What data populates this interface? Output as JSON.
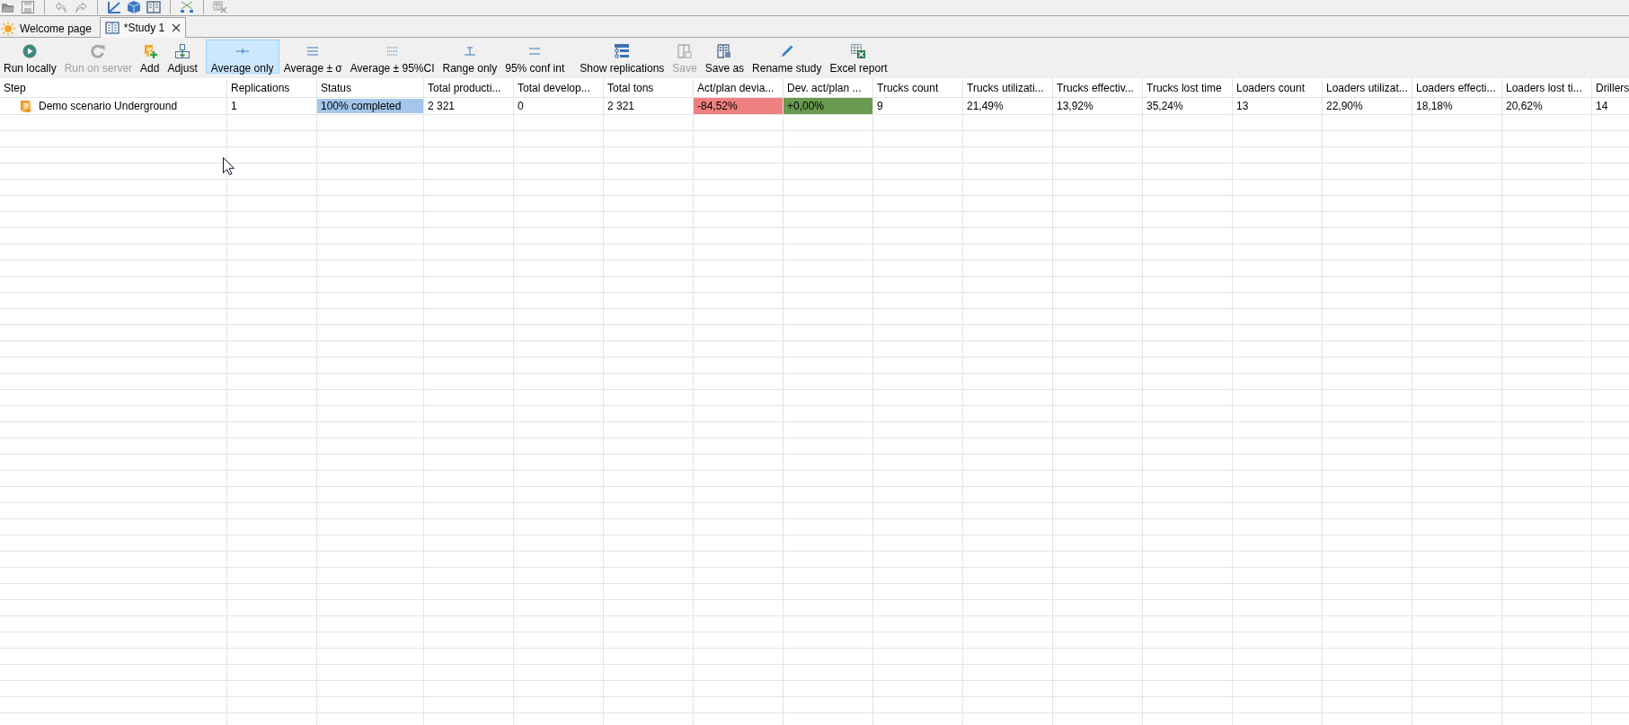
{
  "tabs": [
    {
      "kind": "welcome",
      "label": "Welcome page",
      "selected": false
    },
    {
      "kind": "study",
      "label": "*Study 1",
      "selected": true
    }
  ],
  "toolbar": {
    "run_group": [
      {
        "kind": "run",
        "label": "Run locally",
        "disabled": false
      },
      {
        "kind": "server",
        "label": "Run on server",
        "disabled": true
      },
      {
        "kind": "add",
        "label": "Add",
        "disabled": false
      },
      {
        "kind": "adjust",
        "label": "Adjust",
        "disabled": false
      }
    ],
    "display_modes": [
      {
        "kind": "average",
        "label": "Average only",
        "selected": true
      },
      {
        "kind": "sigma",
        "label": "Average ± σ",
        "selected": false
      },
      {
        "kind": "ci",
        "label": "Average ± 95%CI",
        "selected": false
      },
      {
        "kind": "range",
        "label": "Range only",
        "selected": false
      },
      {
        "kind": "conf",
        "label": "95% conf int",
        "selected": false
      }
    ],
    "actions": [
      {
        "kind": "replications",
        "label": "Show replications",
        "disabled": false
      },
      {
        "kind": "save",
        "label": "Save",
        "disabled": true
      },
      {
        "kind": "save_as",
        "label": "Save as",
        "disabled": false
      },
      {
        "kind": "rename",
        "label": "Rename study",
        "disabled": false
      },
      {
        "kind": "excel",
        "label": "Excel report",
        "disabled": false
      }
    ]
  },
  "table": {
    "columns": [
      "Step",
      "Replications",
      "Status",
      "Total producti...",
      "Total develop...",
      "Total tons",
      "Act/plan devia...",
      "Dev. act/plan ...",
      "Trucks count",
      "Trucks utilizati...",
      "Trucks effectiv...",
      "Trucks lost time",
      "Loaders count",
      "Loaders utilizat...",
      "Loaders effecti...",
      "Loaders lost ti...",
      "Drillers"
    ],
    "rows": [
      {
        "cells": [
          {
            "kind": "step",
            "text": "Demo scenario Underground"
          },
          {
            "kind": "value",
            "text": "1"
          },
          {
            "kind": "progress",
            "text": "100% completed",
            "level": 1
          },
          {
            "kind": "value",
            "text": "2 321"
          },
          {
            "kind": "value",
            "text": "0"
          },
          {
            "kind": "value",
            "text": "2 321"
          },
          {
            "kind": "value",
            "text": "-84,52%",
            "color": "#f08080"
          },
          {
            "kind": "value",
            "text": "+0,00%",
            "color": "#6a9a4f"
          },
          {
            "kind": "value",
            "text": "9"
          },
          {
            "kind": "value",
            "text": "21,49%"
          },
          {
            "kind": "value",
            "text": "13,92%"
          },
          {
            "kind": "value",
            "text": "35,24%"
          },
          {
            "kind": "value",
            "text": "13"
          },
          {
            "kind": "value",
            "text": "22,90%"
          },
          {
            "kind": "value",
            "text": "18,18%"
          },
          {
            "kind": "value",
            "text": "20,62%"
          },
          {
            "kind": "value",
            "text": "14"
          }
        ]
      }
    ]
  }
}
